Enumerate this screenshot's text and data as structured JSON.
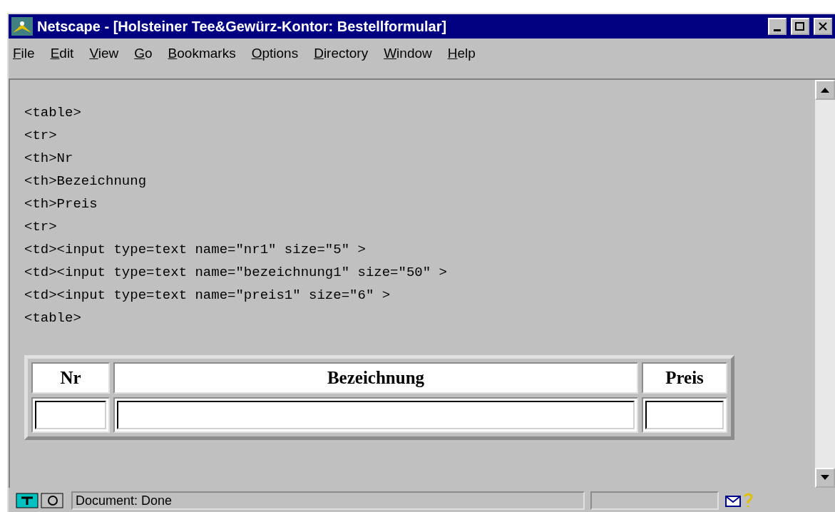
{
  "window": {
    "title": "Netscape - [Holsteiner Tee&Gewürz-Kontor: Bestellformular]"
  },
  "menu": [
    "File",
    "Edit",
    "View",
    "Go",
    "Bookmarks",
    "Options",
    "Directory",
    "Window",
    "Help"
  ],
  "code_lines": [
    "<table>",
    "<tr>",
    "<th>Nr",
    "<th>Bezeichnung",
    "<th>Preis",
    "<tr>",
    "<td><input type=text name=\"nr1\" size=\"5\" >",
    "<td><input type=text name=\"bezeichnung1\" size=\"50\" >",
    "<td><input type=text name=\"preis1\" size=\"6\" >",
    "<table>"
  ],
  "table": {
    "columns": [
      "Nr",
      "Bezeichnung",
      "Preis"
    ]
  },
  "status_bar": {
    "text": "Document: Done"
  }
}
